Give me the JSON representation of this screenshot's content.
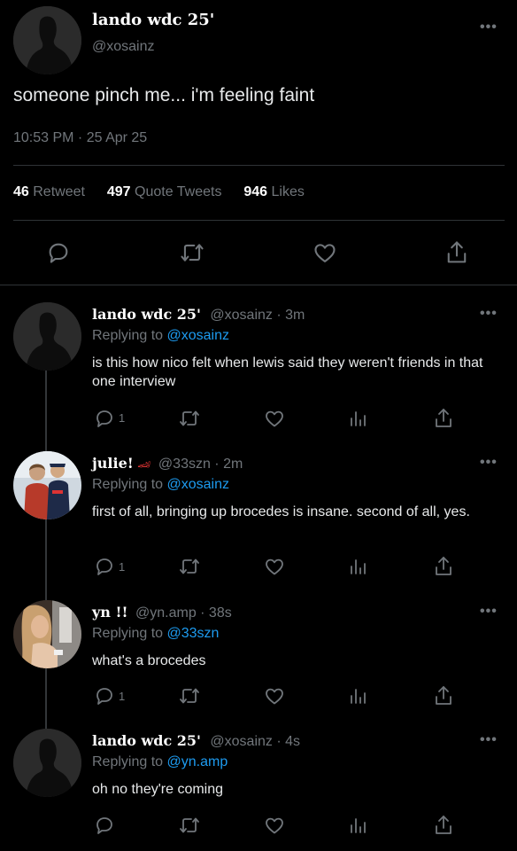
{
  "main_tweet": {
    "display_name": "lando wdc 25'",
    "handle": "@xosainz",
    "text": "someone pinch me... i'm feeling faint",
    "timestamp": "10:53 PM · 25 Apr 25",
    "stats": {
      "retweets": "46",
      "retweets_label": "Retweet",
      "quotes": "497",
      "quotes_label": "Quote Tweets",
      "likes": "946",
      "likes_label": "Likes"
    }
  },
  "replies": [
    {
      "display_name": "lando wdc 25'",
      "emoji": "",
      "meta": "@xosainz · 3m",
      "replying_label": "Replying to",
      "replying_to": "@xosainz",
      "text": "is this how nico felt when lewis said they weren't friends in that one interview",
      "reply_count": "1"
    },
    {
      "display_name": "julie!",
      "emoji": "🏎",
      "meta": "@33szn · 2m",
      "replying_label": "Replying to",
      "replying_to": "@xosainz",
      "text": "first of all, bringing up brocedes is insane. second of all, yes.",
      "reply_count": "1"
    },
    {
      "display_name": "yn !!",
      "emoji": "",
      "meta": "@yn.amp · 38s",
      "replying_label": "Replying to",
      "replying_to": "@33szn",
      "text": "what's a brocedes",
      "reply_count": "1"
    },
    {
      "display_name": "lando wdc 25'",
      "emoji": "",
      "meta": "@xosainz · 4s",
      "replying_label": "Replying to",
      "replying_to": "@yn.amp",
      "text": "oh no they're coming",
      "reply_count": ""
    }
  ],
  "icons": {
    "more": "more-options-icon",
    "reply": "reply-icon",
    "retweet": "retweet-icon",
    "like": "like-icon",
    "views": "views-icon",
    "share": "share-icon"
  },
  "colors": {
    "background": "#000000",
    "link": "#1d9bf0",
    "muted": "#71767b",
    "text": "#e7e9ea"
  }
}
